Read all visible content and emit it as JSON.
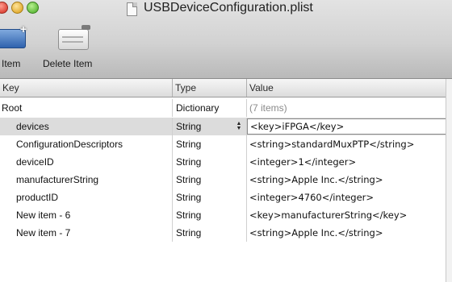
{
  "window": {
    "title": "USBDeviceConfiguration.plist",
    "doc_icon": "document-icon"
  },
  "toolbar": {
    "add_label": "d Item",
    "delete_label": "Delete Item"
  },
  "table": {
    "headers": {
      "key": "Key",
      "type": "Type",
      "value": "Value"
    },
    "rows": [
      {
        "key": "Root",
        "type": "Dictionary",
        "value": "(7 items)"
      },
      {
        "key": "devices",
        "type": "String",
        "value": "<key>iFPGA</key>"
      },
      {
        "key": "ConfigurationDescriptors",
        "type": "String",
        "value": "<string>standardMuxPTP</string>"
      },
      {
        "key": "deviceID",
        "type": "String",
        "value": "<integer>1</integer>"
      },
      {
        "key": "manufacturerString",
        "type": "String",
        "value": "<string>Apple Inc.</string>"
      },
      {
        "key": "productID",
        "type": "String",
        "value": "<integer>4760</integer>"
      },
      {
        "key": "New item - 6",
        "type": "String",
        "value": "<key>manufacturerString</key>"
      },
      {
        "key": "New item - 7",
        "type": "String",
        "value": "<string>Apple Inc.</string>"
      }
    ]
  },
  "colors": {
    "selected_row": "#dcdcdc",
    "muted_text": "#8a8a8a"
  }
}
